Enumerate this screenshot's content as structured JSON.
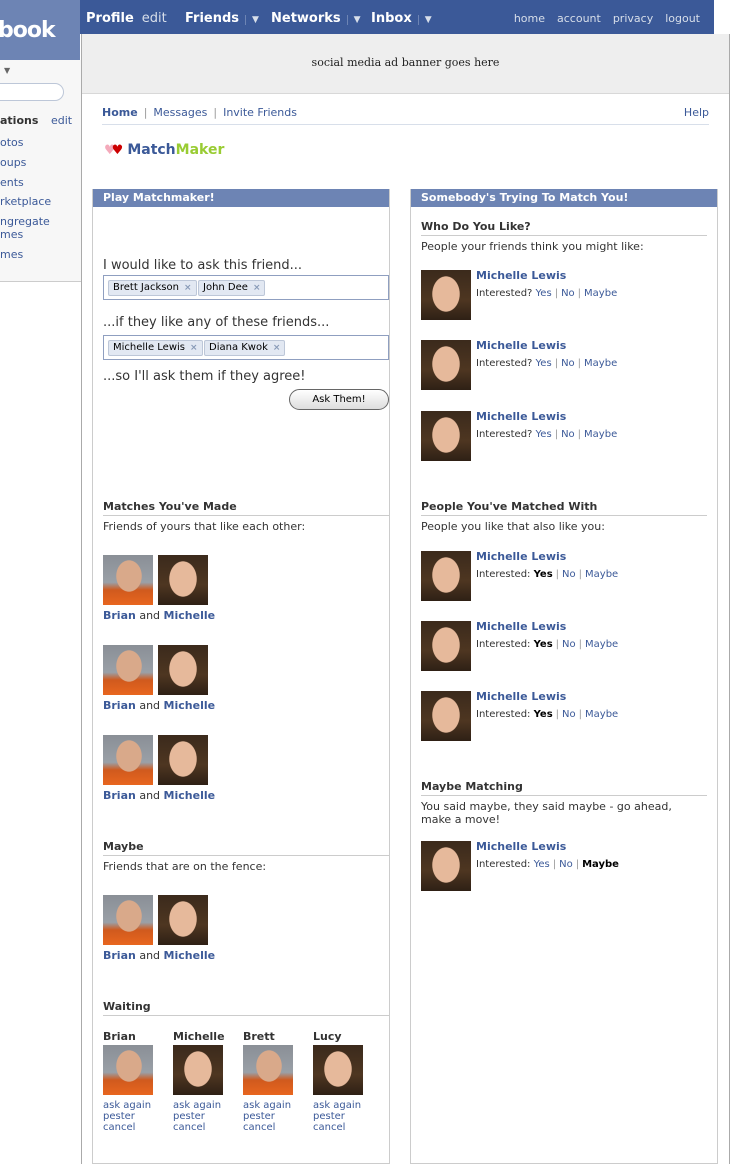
{
  "topbar": {
    "logo": "book",
    "nav": [
      {
        "label": "Profile",
        "sub": "edit"
      },
      {
        "label": "Friends",
        "caret": "▼"
      },
      {
        "label": "Networks",
        "caret": "▼"
      },
      {
        "label": "Inbox",
        "caret": "▼"
      }
    ],
    "links": [
      "home",
      "account",
      "privacy",
      "logout"
    ]
  },
  "sidebar": {
    "caret": "▼",
    "apps_label": "ations",
    "edit_label": "edit",
    "items": [
      "otos",
      "oups",
      "ents",
      "rketplace",
      "ngregate",
      "mes",
      "mes"
    ]
  },
  "ad_banner": "social media ad banner goes here",
  "appnav": {
    "home": "Home",
    "messages": "Messages",
    "invite": "Invite Friends",
    "help": "Help"
  },
  "app_logo": {
    "part1": "Match",
    "part2": "Maker"
  },
  "left": {
    "header": "Play Matchmaker!",
    "ask_label": "I would like to ask this friend...",
    "ask_tokens": [
      "Brett Jackson",
      "John Dee"
    ],
    "like_label": "...if they like any of these friends...",
    "like_tokens": [
      "Michelle Lewis",
      "Diana Kwok"
    ],
    "agree_label": "...so I'll ask them if they agree!",
    "ask_button": "Ask Them!",
    "matches": {
      "title": "Matches You've Made",
      "desc": "Friends of yours that like each other:",
      "pairs": [
        {
          "a": "Brian",
          "and": "and",
          "b": "Michelle"
        },
        {
          "a": "Brian",
          "and": "and",
          "b": "Michelle"
        },
        {
          "a": "Brian",
          "and": "and",
          "b": "Michelle"
        }
      ]
    },
    "maybe": {
      "title": "Maybe",
      "desc": "Friends that are on the fence:",
      "pairs": [
        {
          "a": "Brian",
          "and": "and",
          "b": "Michelle"
        }
      ]
    },
    "waiting": {
      "title": "Waiting",
      "people": [
        {
          "name": "Brian",
          "gender": "m"
        },
        {
          "name": "Michelle",
          "gender": "f"
        },
        {
          "name": "Brett",
          "gender": "m"
        },
        {
          "name": "Lucy",
          "gender": "f"
        }
      ],
      "actions": [
        "ask again",
        "pester",
        "cancel"
      ]
    }
  },
  "right": {
    "header": "Somebody's Trying To Match You!",
    "who": {
      "title": "Who Do You Like?",
      "desc": "People your friends think you might like:",
      "people": [
        {
          "name": "Michelle Lewis",
          "interested": "Interested?",
          "yes": "Yes",
          "no": "No",
          "maybe": "Maybe"
        },
        {
          "name": "Michelle Lewis",
          "interested": "Interested?",
          "yes": "Yes",
          "no": "No",
          "maybe": "Maybe"
        },
        {
          "name": "Michelle Lewis",
          "interested": "Interested?",
          "yes": "Yes",
          "no": "No",
          "maybe": "Maybe"
        }
      ]
    },
    "matched": {
      "title": "People You've Matched With",
      "desc": "People you like that also like you:",
      "people": [
        {
          "name": "Michelle Lewis",
          "interested": "Interested:",
          "yes": "Yes",
          "no": "No",
          "maybe": "Maybe"
        },
        {
          "name": "Michelle Lewis",
          "interested": "Interested:",
          "yes": "Yes",
          "no": "No",
          "maybe": "Maybe"
        },
        {
          "name": "Michelle Lewis",
          "interested": "Interested:",
          "yes": "Yes",
          "no": "No",
          "maybe": "Maybe"
        }
      ]
    },
    "maybe_matching": {
      "title": "Maybe Matching",
      "desc": "You said maybe, they said maybe - go ahead, make a move!",
      "people": [
        {
          "name": "Michelle Lewis",
          "interested": "Interested:",
          "yes": "Yes",
          "no": "No",
          "maybe": "Maybe"
        }
      ]
    }
  }
}
